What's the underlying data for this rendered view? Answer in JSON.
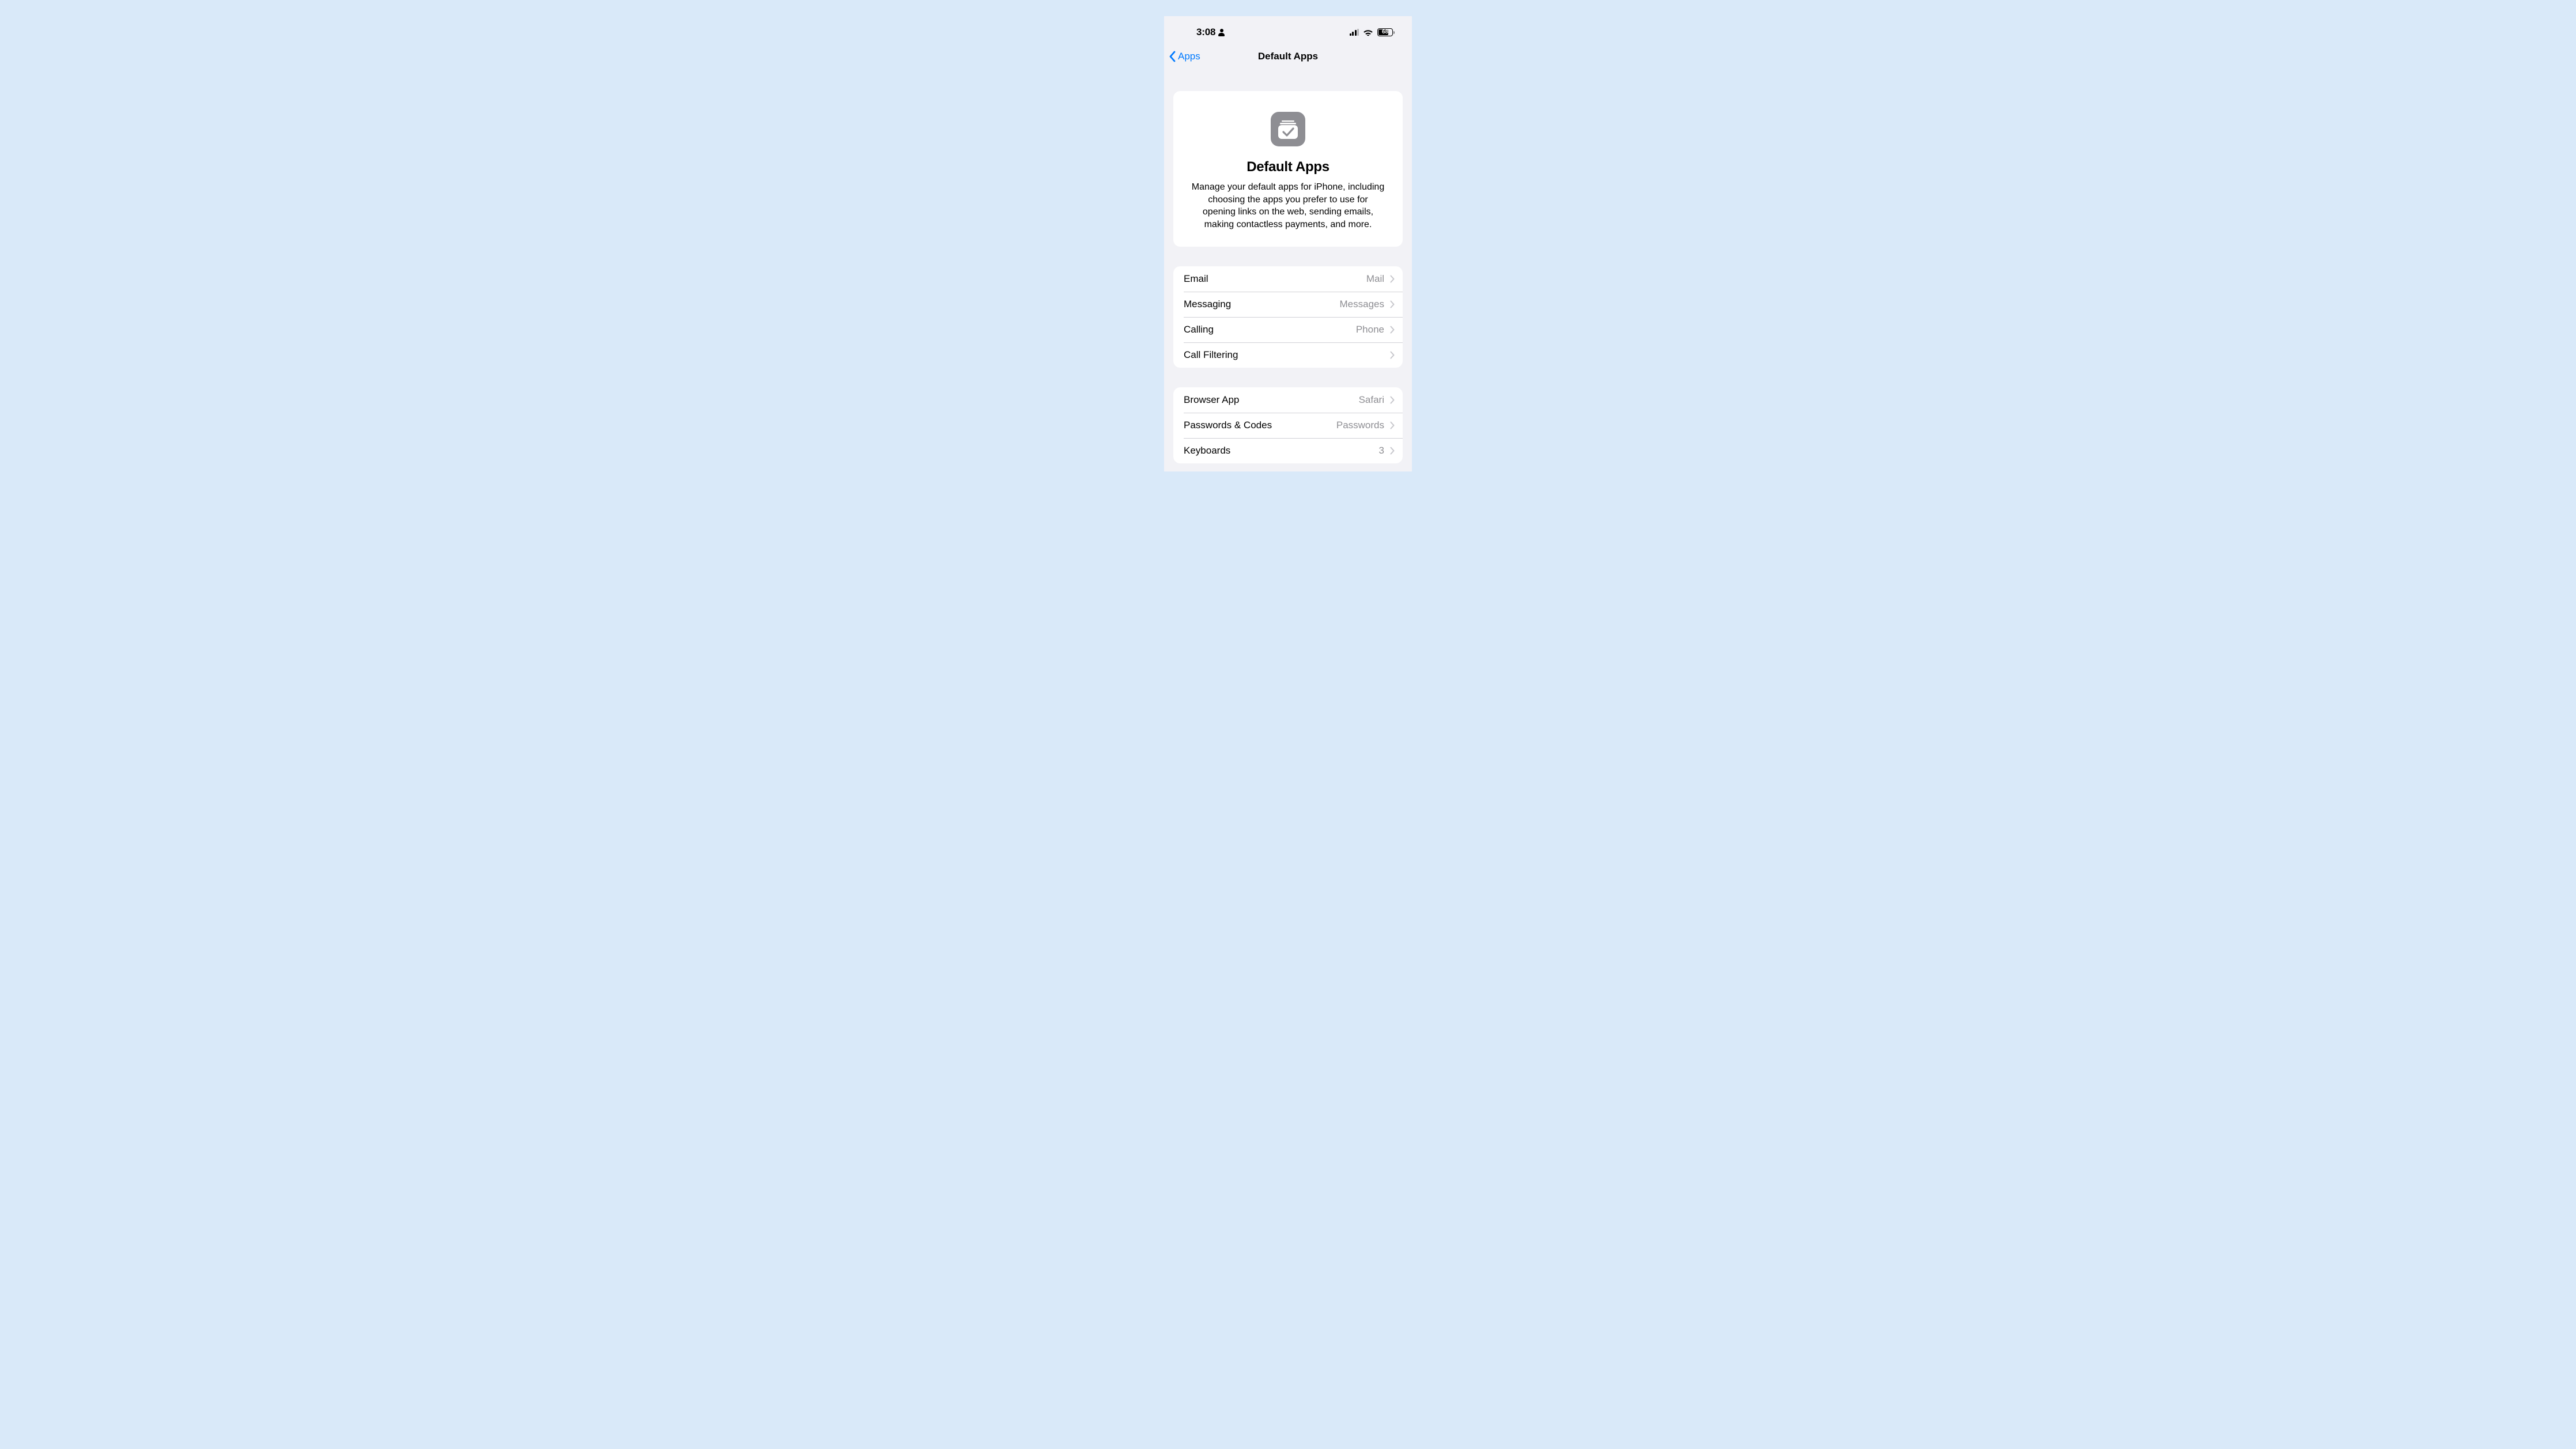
{
  "status": {
    "time": "3:08",
    "battery_percent": "68"
  },
  "nav": {
    "back_label": "Apps",
    "title": "Default Apps"
  },
  "intro": {
    "title": "Default Apps",
    "description": "Manage your default apps for iPhone, including choosing the apps you prefer to use for opening links on the web, sending emails, making contactless payments, and more."
  },
  "group1": [
    {
      "label": "Email",
      "value": "Mail"
    },
    {
      "label": "Messaging",
      "value": "Messages"
    },
    {
      "label": "Calling",
      "value": "Phone"
    },
    {
      "label": "Call Filtering",
      "value": ""
    }
  ],
  "group2": [
    {
      "label": "Browser App",
      "value": "Safari"
    },
    {
      "label": "Passwords & Codes",
      "value": "Passwords"
    },
    {
      "label": "Keyboards",
      "value": "3"
    }
  ]
}
